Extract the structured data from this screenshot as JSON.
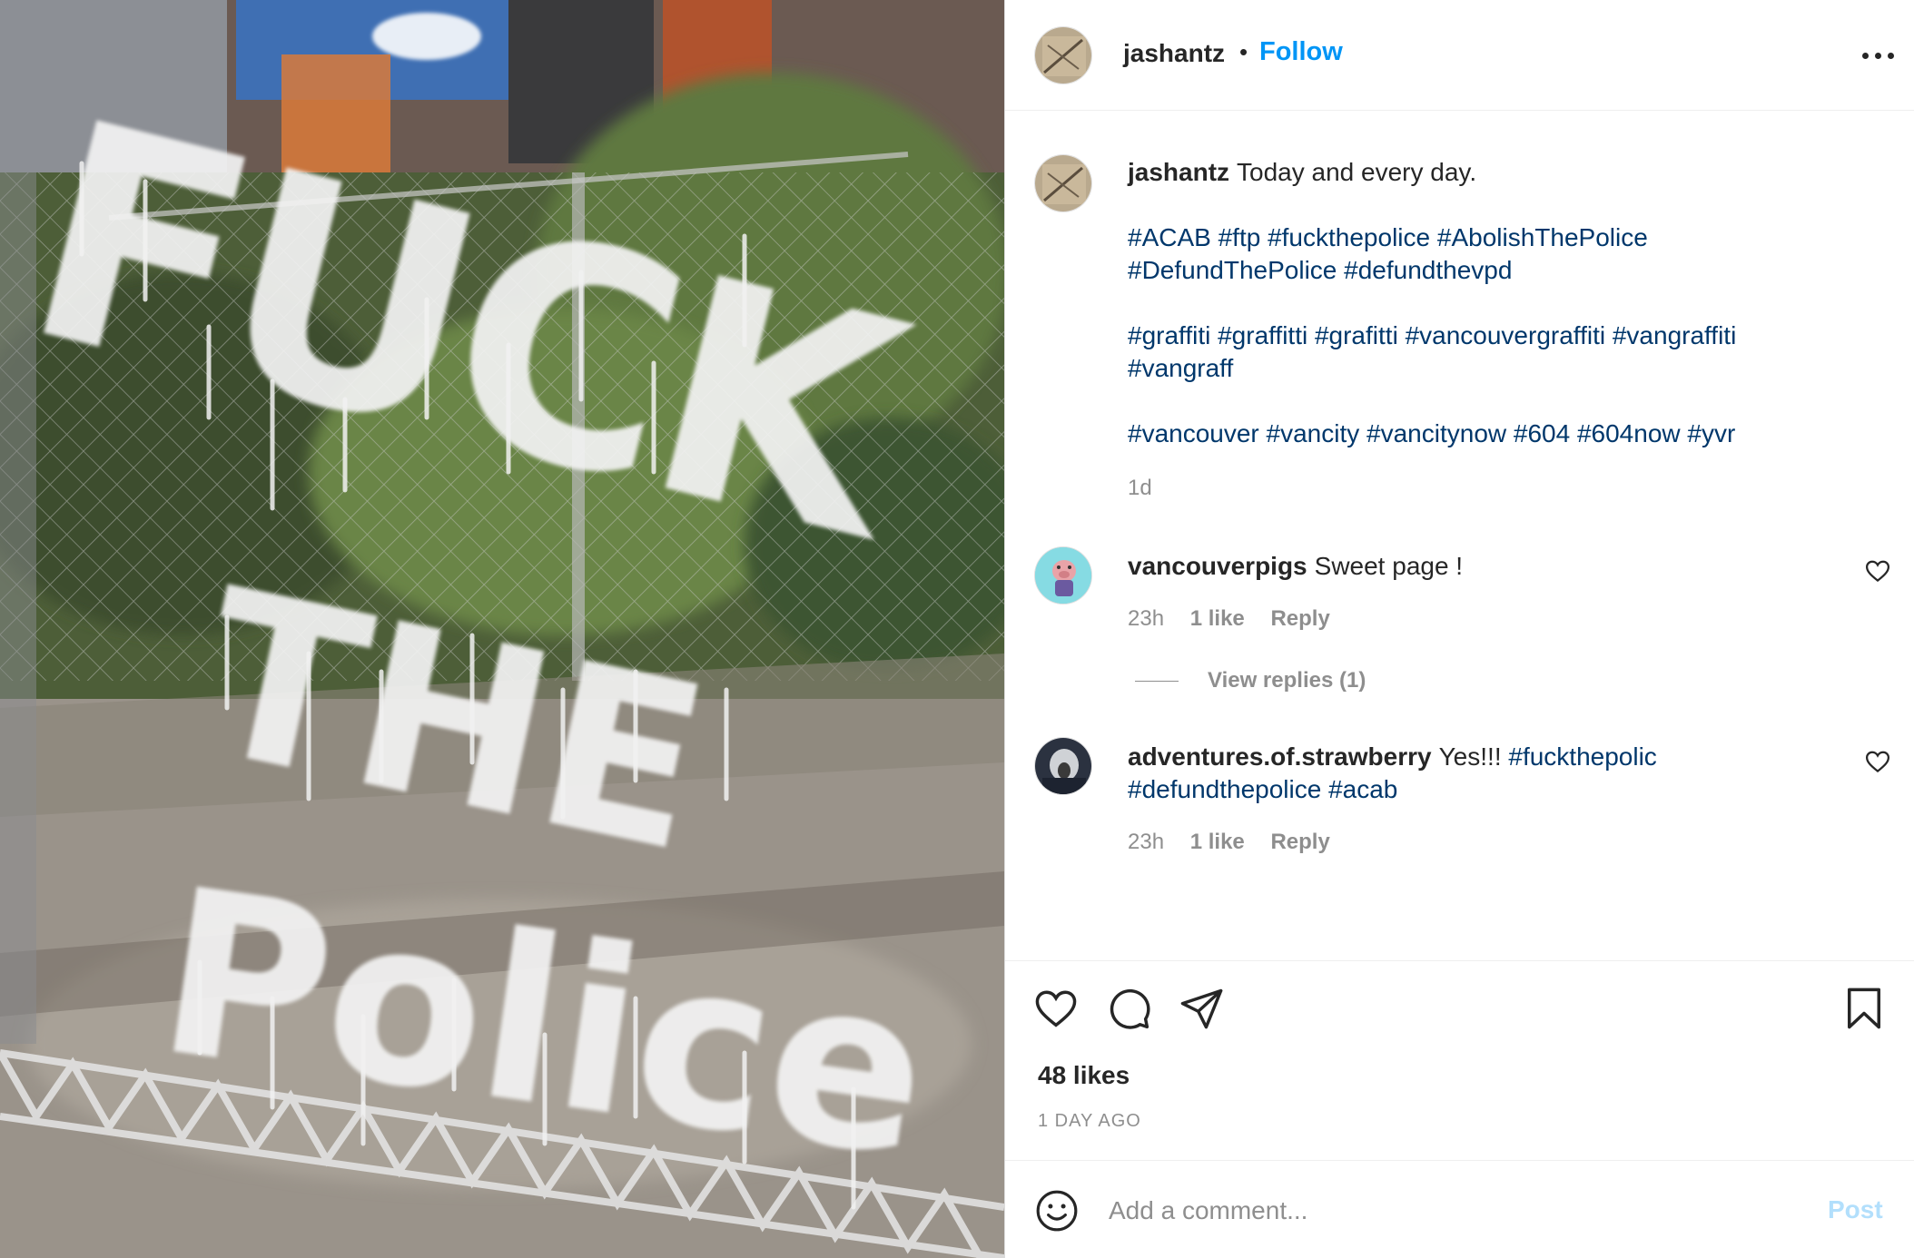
{
  "post": {
    "author": "jashantz",
    "separator": "•",
    "follow_label": "Follow",
    "more_icon": "more-horizontal-icon"
  },
  "caption": {
    "author": "jashantz",
    "text": "Today and every day.",
    "hashtag_lines": [
      "#ACAB #ftp #fuckthepolice #AbolishThePolice",
      "#DefundThePolice #defundthevpd",
      "#graffiti #graffitti #grafitti #vancouvergraffiti #vangraffiti",
      "#vangraff",
      "#vancouver #vancity #vancitynow #604 #604now #yvr"
    ],
    "time": "1d"
  },
  "comments": [
    {
      "author": "vancouverpigs",
      "text": "Sweet page !",
      "tags": "",
      "time": "23h",
      "likes": "1 like",
      "reply_label": "Reply",
      "view_replies": "View replies (1)"
    },
    {
      "author": "adventures.of.strawberry",
      "text": "Yes!!!",
      "tags_line1": "#fuckthepolic",
      "tags_line2": "#defundthepolice #acab",
      "time": "23h",
      "likes": "1 like",
      "reply_label": "Reply"
    }
  ],
  "actions": {
    "like_icon": "heart-icon",
    "comment_icon": "comment-icon",
    "share_icon": "paper-plane-icon",
    "save_icon": "bookmark-icon",
    "likes_count": "48 likes",
    "date": "1 DAY AGO"
  },
  "composer": {
    "placeholder": "Add a comment...",
    "post_label": "Post",
    "emoji_icon": "emoji-icon"
  },
  "photo": {
    "graffiti_lines": [
      "FUCK",
      "THE",
      "Police"
    ]
  },
  "colors": {
    "link_blue": "#0095f6",
    "hashtag": "#00376b",
    "muted": "#8e8e8e",
    "post_disabled": "#b2dffc"
  }
}
